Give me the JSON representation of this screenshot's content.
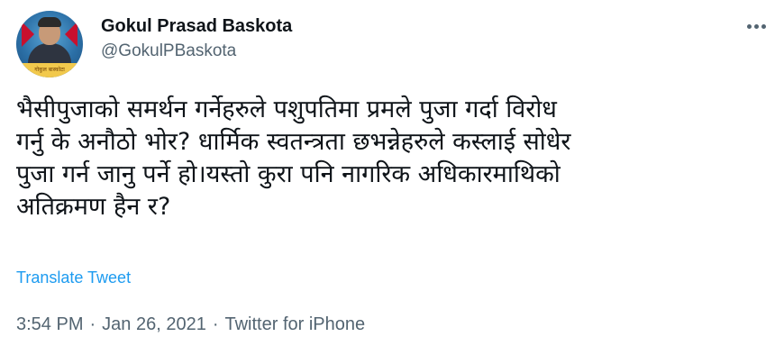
{
  "author": {
    "display_name": "Gokul Prasad Baskota",
    "handle": "@GokulPBaskota",
    "avatar_caption": "गोकुल बास्कोटा"
  },
  "tweet": {
    "text": "भैसीपुजाको समर्थन गर्नेहरुले पशुपतिमा प्रमले पुजा गर्दा विरोध\nगर्नु के अनौठो भोर? धार्मिक स्वतन्त्रता छभन्नेहरुले कस्लाई सोधेर\nपुजा गर्न जानु पर्ने हो।यस्तो कुरा पनि नागरिक अधिकारमाथिको\nअतिक्रमण हैन र?",
    "translate_label": "Translate Tweet"
  },
  "meta": {
    "time": "3:54 PM",
    "separator": "·",
    "date": "Jan 26, 2021",
    "source": "Twitter for iPhone"
  },
  "icons": {
    "more": "more-horizontal-icon"
  },
  "colors": {
    "text": "#0f1419",
    "secondary": "#536471",
    "link": "#1d9bf0"
  }
}
